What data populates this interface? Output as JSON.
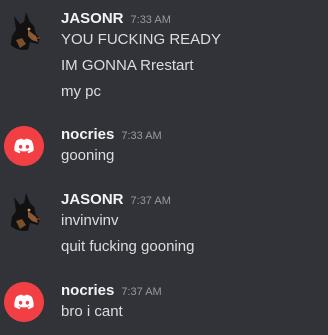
{
  "messages": [
    {
      "username": "JASONR",
      "timestamp": "7:33 AM",
      "avatar_icon": "doberman-avatar-icon",
      "lines": [
        "YOU FUCKING READY",
        "IM GONNA Rrestart",
        "my pc"
      ]
    },
    {
      "username": "nocries",
      "timestamp": "7:33 AM",
      "avatar_icon": "discord-logo-avatar-icon",
      "avatar_color": "#f23f43",
      "lines": [
        "gooning"
      ]
    },
    {
      "username": "JASONR",
      "timestamp": "7:37 AM",
      "avatar_icon": "doberman-avatar-icon",
      "lines": [
        "invinvinv",
        "quit fucking gooning"
      ]
    },
    {
      "username": "nocries",
      "timestamp": "7:37 AM",
      "avatar_icon": "discord-logo-avatar-icon",
      "avatar_color": "#f23f43",
      "lines": [
        "bro i cant"
      ]
    }
  ]
}
